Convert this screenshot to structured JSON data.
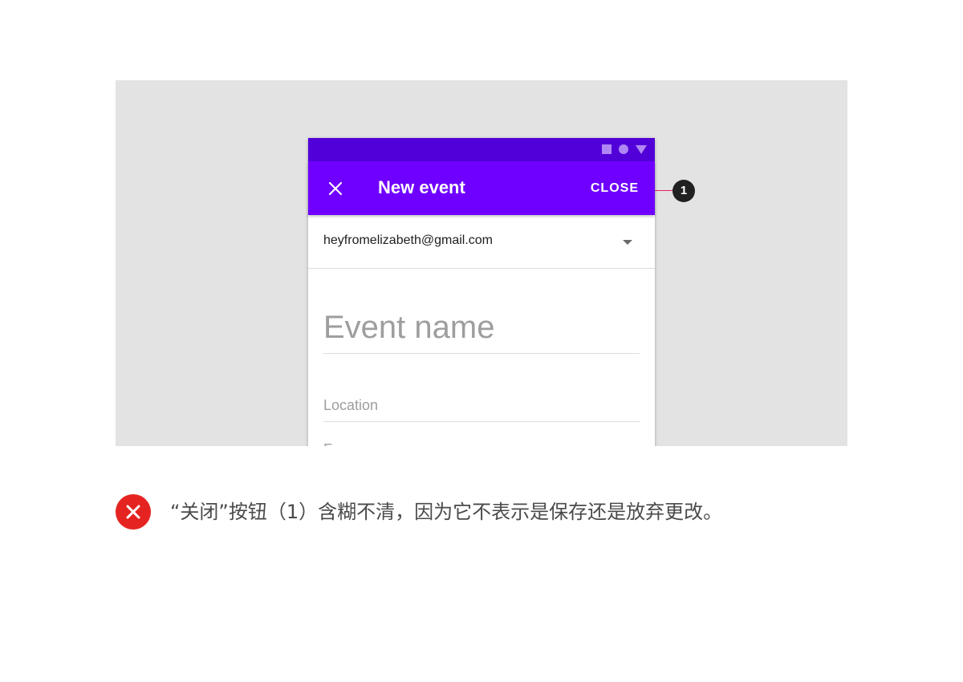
{
  "colors": {
    "status_bar": "#5200d8",
    "app_bar": "#6f00ff",
    "stage_background": "#e3e3e3",
    "callout_line": "#e0245e",
    "dont_icon": "#e52421"
  },
  "status_bar": {
    "icons": [
      "square-icon",
      "circle-icon",
      "triangle-icon"
    ]
  },
  "app_bar": {
    "nav_icon": "close-icon",
    "title": "New event",
    "action_label": "CLOSE"
  },
  "account": {
    "email": "heyfromelizabeth@gmail.com",
    "dropdown_icon": "arrow-drop-down-icon"
  },
  "form": {
    "event_name_placeholder": "Event name",
    "location_placeholder": "Location",
    "cut_off_label": "F"
  },
  "callout": {
    "number": "1"
  },
  "caption": {
    "icon": "dont-x-icon",
    "text": "“关闭”按钮（1）含糊不清，因为它不表示是保存还是放弃更改。"
  }
}
